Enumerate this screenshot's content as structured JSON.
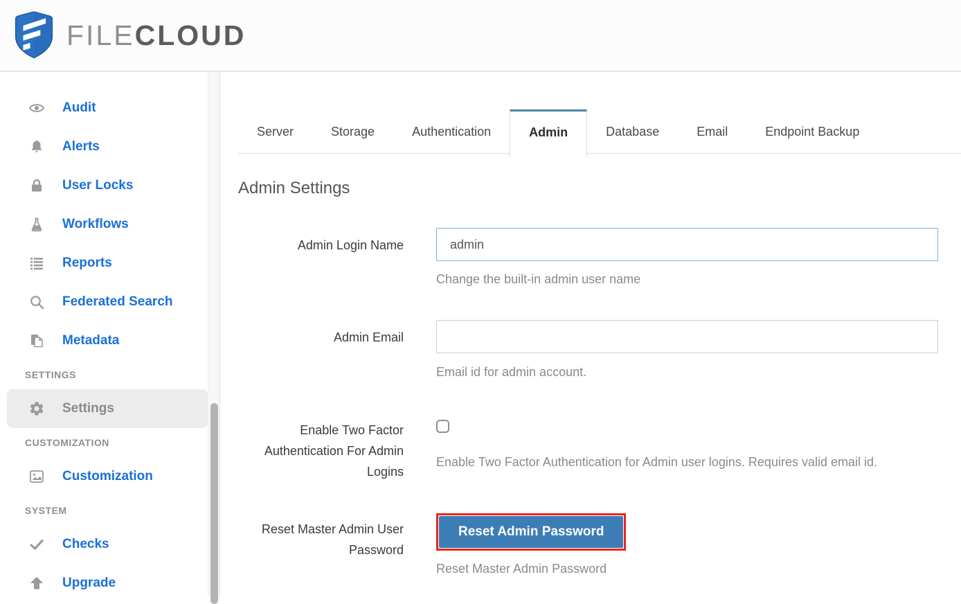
{
  "header": {
    "logo": {
      "part1": "FILE",
      "part2": "CLOUD"
    }
  },
  "sidebar": {
    "items": [
      {
        "label": "Audit",
        "icon": "eye-icon"
      },
      {
        "label": "Alerts",
        "icon": "bell-icon"
      },
      {
        "label": "User Locks",
        "icon": "lock-icon"
      },
      {
        "label": "Workflows",
        "icon": "flask-icon"
      },
      {
        "label": "Reports",
        "icon": "list-icon"
      },
      {
        "label": "Federated Search",
        "icon": "search-icon"
      },
      {
        "label": "Metadata",
        "icon": "copy-icon"
      },
      {
        "label": "SETTINGS",
        "type": "section"
      },
      {
        "label": "Settings",
        "icon": "gear-icon",
        "active": true
      },
      {
        "label": "CUSTOMIZATION",
        "type": "section"
      },
      {
        "label": "Customization",
        "icon": "image-icon"
      },
      {
        "label": "SYSTEM",
        "type": "section"
      },
      {
        "label": "Checks",
        "icon": "check-icon"
      },
      {
        "label": "Upgrade",
        "icon": "arrow-up-icon"
      }
    ]
  },
  "tabs": {
    "active": "Admin",
    "items": [
      {
        "label": "Server"
      },
      {
        "label": "Storage"
      },
      {
        "label": "Authentication"
      },
      {
        "label": "Admin"
      },
      {
        "label": "Database"
      },
      {
        "label": "Email"
      },
      {
        "label": "Endpoint Backup"
      }
    ]
  },
  "main": {
    "title": "Admin Settings",
    "fields": {
      "admin_login_name": {
        "label": "Admin Login Name",
        "value": "admin",
        "help": "Change the built-in admin user name"
      },
      "admin_email": {
        "label": "Admin Email",
        "value": "",
        "help": "Email id for admin account."
      },
      "two_factor": {
        "label": "Enable Two Factor Authentication For Admin Logins",
        "checked": false,
        "help": "Enable Two Factor Authentication for Admin user logins. Requires valid email id."
      },
      "reset_password": {
        "label": "Reset Master Admin User Password",
        "button_label": "Reset Admin Password",
        "help": "Reset Master Admin Password"
      }
    }
  },
  "colors": {
    "link_blue": "#1a70d8",
    "button_blue": "#3d7db5",
    "active_tab_accent": "#4a87a5",
    "annotation_red": "#e8251d",
    "brand_shield_blue": "#2d72c3",
    "input_focus_border": "#70b4e4"
  }
}
